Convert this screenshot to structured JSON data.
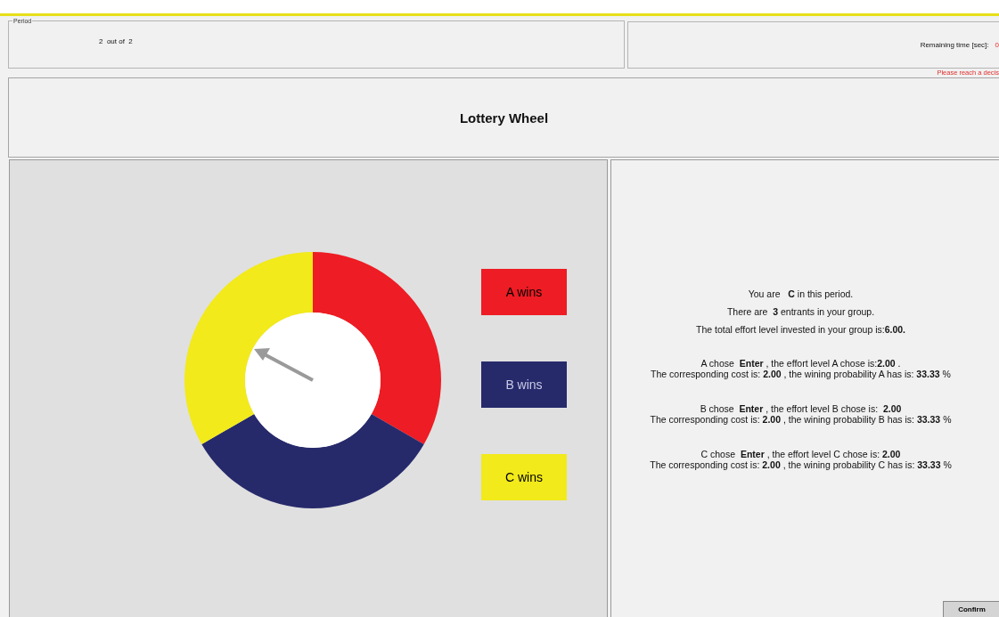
{
  "period": {
    "legend": "Period",
    "current": "2",
    "separator": "out of",
    "total": "2"
  },
  "timer": {
    "label": "Remaining time [sec]:",
    "value": "0"
  },
  "warning": "Please reach a decis",
  "title": "Lottery Wheel",
  "legend": [
    {
      "label": "A wins",
      "color": "#ee1c24"
    },
    {
      "label": "B wins",
      "color": "#262a6b"
    },
    {
      "label": "C wins",
      "color": "#f2ea1a"
    }
  ],
  "info": [
    "You are   **C** in this period.",
    "There are  **3** entrants in your group.",
    "The total effort level invested in your group is:**6.00.**"
  ],
  "choices": [
    [
      "A chose  **Enter** , the effort level A chose is:**2.00** .",
      "The corresponding cost is: **2.00** , the wining probability A has is: **33.33** %"
    ],
    [
      "B chose  **Enter** , the effort level B chose is:  **2.00**",
      "The corresponding cost is: **2.00** , the wining probability B has is: **33.33** %"
    ],
    [
      "C chose  **Enter** , the effort level C chose is: **2.00**",
      "The corresponding cost is: **2.00** , the wining probability C has is: **33.33** %"
    ]
  ],
  "confirm_button": "Confirm"
}
